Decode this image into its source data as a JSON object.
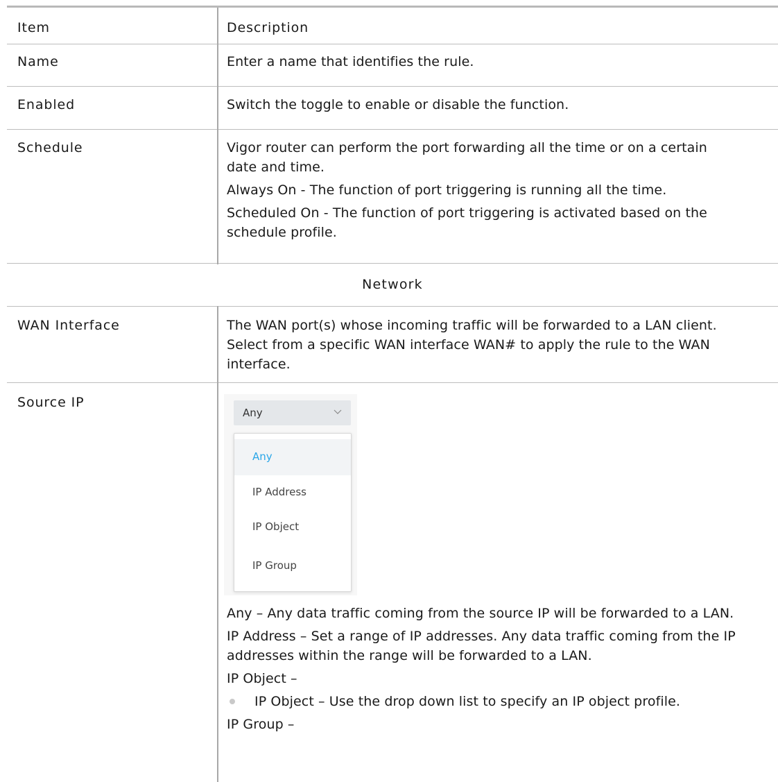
{
  "table": {
    "headers": {
      "item": "Item",
      "description": "Description"
    },
    "rows": [
      {
        "item": "Name",
        "description": [
          "Enter a name that identifies the rule."
        ]
      },
      {
        "item": "Enabled",
        "description": [
          "Switch the toggle to enable or disable the function."
        ]
      },
      {
        "item": "Schedule",
        "description": [
          "Vigor router can perform the port forwarding all the time or on a certain date and time.",
          "Always On - The function of port triggering is running all the time.",
          "Scheduled On - The function of port triggering is activated based on the schedule profile."
        ]
      },
      {
        "section": "Network"
      },
      {
        "item": "WAN Interface",
        "description": [
          "The WAN port(s) whose incoming traffic will be forwarded to a LAN client. Select from a specific WAN interface WAN# to apply the rule to the WAN interface."
        ]
      },
      {
        "item": "Source IP",
        "description": [
          "Any – Any data traffic coming from the source IP will be forwarded to a LAN.",
          "IP Address – Set a range of IP addresses. Any data traffic coming from the IP addresses within the range will be forwarded to a LAN.",
          "IP Object –",
          "IP Object – Use the drop down list to specify an IP object profile.",
          "IP Group –"
        ]
      }
    ]
  },
  "dropdown": {
    "selected": "Any",
    "options": [
      "Any",
      "IP Address",
      "IP Object",
      "IP Group"
    ],
    "highlight_color": "#2aa6e8",
    "icon": "chevron-down-icon"
  }
}
